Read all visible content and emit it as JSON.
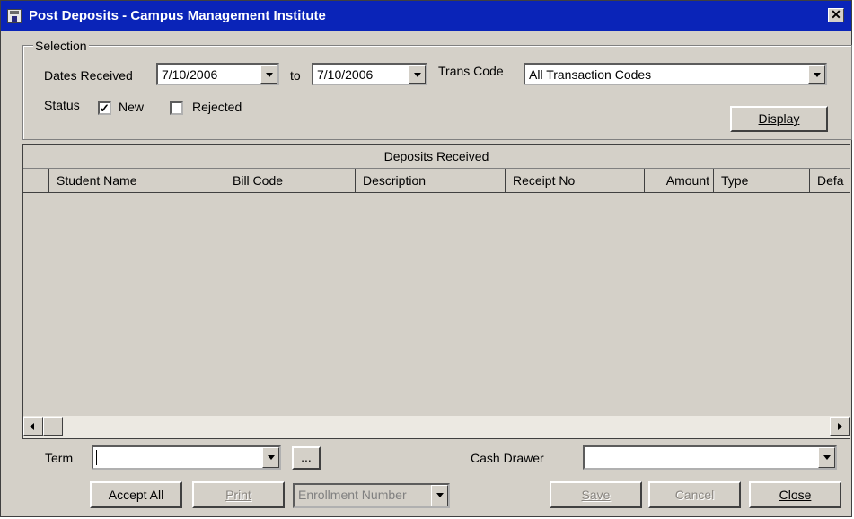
{
  "window": {
    "title": "Post Deposits - Campus Management Institute"
  },
  "selection": {
    "legend": "Selection",
    "dates_label": "Dates Received",
    "date_from": "7/10/2006",
    "to_label": "to",
    "date_to": "7/10/2006",
    "trans_code_label": "Trans Code",
    "trans_code_value": "All Transaction Codes",
    "status_label": "Status",
    "new_label": "New",
    "new_checked": true,
    "rejected_label": "Rejected",
    "rejected_checked": false,
    "display_button": "Display"
  },
  "grid": {
    "band_title": "Deposits Received",
    "columns": [
      "Student Name",
      "Bill Code",
      "Description",
      "Receipt No",
      "Amount",
      "Type",
      "Defa"
    ],
    "rows": []
  },
  "footer": {
    "term_label": "Term",
    "term_value": "",
    "ellipsis_button": "...",
    "cash_drawer_label": "Cash Drawer",
    "cash_drawer_value": "",
    "accept_all_button": "Accept All",
    "print_button": "Print",
    "enrollment_placeholder": "Enrollment Number",
    "save_button": "Save",
    "cancel_button": "Cancel",
    "close_button": "Close"
  },
  "icons": {
    "app_icon": "building-icon",
    "close": "close-icon",
    "dropdown": "chevron-down-icon",
    "check": "checkmark-icon",
    "scroll_left": "arrow-left-icon",
    "scroll_right": "arrow-right-icon"
  },
  "colors": {
    "titlebar": "#0a24b8",
    "face": "#d4d0c8"
  }
}
